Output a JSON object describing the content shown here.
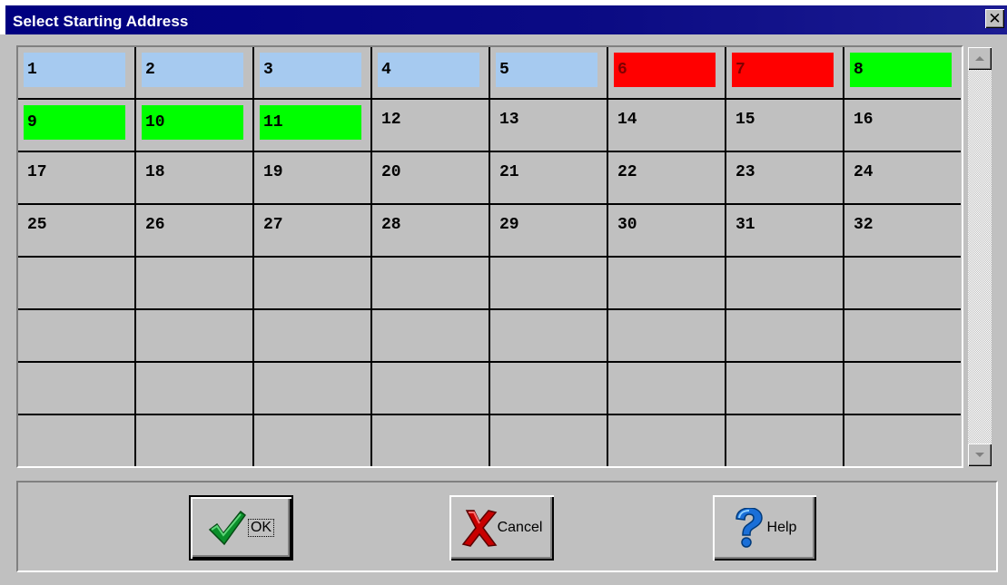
{
  "window": {
    "title": "Select Starting Address",
    "close_label": "✕"
  },
  "colors": {
    "titlebar": "#000080",
    "face": "#c0c0c0",
    "chip_blue": "#a6caf0",
    "chip_red": "#ff0000",
    "chip_green": "#00ff00",
    "chip_text_on_red": "#800000"
  },
  "address_grid": {
    "columns": 8,
    "visible_rows": 8,
    "cells": [
      {
        "label": "1",
        "status": "blue"
      },
      {
        "label": "2",
        "status": "blue"
      },
      {
        "label": "3",
        "status": "blue"
      },
      {
        "label": "4",
        "status": "blue"
      },
      {
        "label": "5",
        "status": "blue"
      },
      {
        "label": "6",
        "status": "red"
      },
      {
        "label": "7",
        "status": "red"
      },
      {
        "label": "8",
        "status": "green"
      },
      {
        "label": "9",
        "status": "green"
      },
      {
        "label": "10",
        "status": "green"
      },
      {
        "label": "11",
        "status": "green"
      },
      {
        "label": "12",
        "status": ""
      },
      {
        "label": "13",
        "status": ""
      },
      {
        "label": "14",
        "status": ""
      },
      {
        "label": "15",
        "status": ""
      },
      {
        "label": "16",
        "status": ""
      },
      {
        "label": "17",
        "status": ""
      },
      {
        "label": "18",
        "status": ""
      },
      {
        "label": "19",
        "status": ""
      },
      {
        "label": "20",
        "status": ""
      },
      {
        "label": "21",
        "status": ""
      },
      {
        "label": "22",
        "status": ""
      },
      {
        "label": "23",
        "status": ""
      },
      {
        "label": "24",
        "status": ""
      },
      {
        "label": "25",
        "status": ""
      },
      {
        "label": "26",
        "status": ""
      },
      {
        "label": "27",
        "status": ""
      },
      {
        "label": "28",
        "status": ""
      },
      {
        "label": "29",
        "status": ""
      },
      {
        "label": "30",
        "status": ""
      },
      {
        "label": "31",
        "status": ""
      },
      {
        "label": "32",
        "status": ""
      }
    ]
  },
  "buttons": {
    "ok": {
      "label": "OK",
      "icon": "green-checkmark-icon"
    },
    "cancel": {
      "label": "Cancel",
      "icon": "red-x-icon"
    },
    "help": {
      "label": "Help",
      "icon": "blue-question-mark-icon"
    }
  }
}
